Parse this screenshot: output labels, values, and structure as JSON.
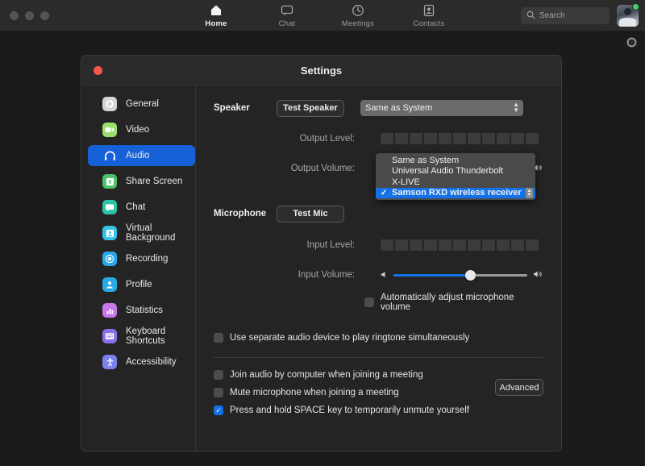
{
  "topbar": {
    "nav": [
      {
        "label": "Home",
        "icon": "home-icon",
        "active": true
      },
      {
        "label": "Chat",
        "icon": "chat-bubble-icon",
        "active": false
      },
      {
        "label": "Meetings",
        "icon": "clock-icon",
        "active": false
      },
      {
        "label": "Contacts",
        "icon": "contact-card-icon",
        "active": false
      }
    ],
    "search": {
      "placeholder": "Search",
      "icon": "search-icon"
    },
    "avatar": {
      "name": "user-avatar",
      "status": "available"
    },
    "gear": "gear-icon"
  },
  "settings": {
    "title": "Settings",
    "close_label": "close",
    "sidebar": [
      {
        "label": "General",
        "icon": "gear-icon",
        "color": "#d4d4d4",
        "active": false
      },
      {
        "label": "Video",
        "icon": "video-camera-icon",
        "color": "#9ade6f",
        "active": false
      },
      {
        "label": "Audio",
        "icon": "headphones-icon",
        "color": "#1661d8",
        "active": true
      },
      {
        "label": "Share Screen",
        "icon": "share-screen-icon",
        "color": "#4cc36a",
        "active": false
      },
      {
        "label": "Chat",
        "icon": "chat-bubble-icon",
        "color": "#2ec4a6",
        "active": false
      },
      {
        "label": "Virtual Background",
        "icon": "person-frame-icon",
        "color": "#36c3e8",
        "active": false
      },
      {
        "label": "Recording",
        "icon": "record-dot-icon",
        "color": "#2aa9e8",
        "active": false
      },
      {
        "label": "Profile",
        "icon": "person-icon",
        "color": "#29a9e6",
        "active": false
      },
      {
        "label": "Statistics",
        "icon": "bar-chart-icon",
        "color": "#c877e8",
        "active": false
      },
      {
        "label": "Keyboard Shortcuts",
        "icon": "keyboard-icon",
        "color": "#8a6fe8",
        "active": false
      },
      {
        "label": "Accessibility",
        "icon": "accessibility-icon",
        "color": "#7b82ea",
        "active": false
      }
    ],
    "speaker": {
      "section_label": "Speaker",
      "test_button": "Test Speaker",
      "selected_device": "Same as System",
      "output_level_label": "Output Level:",
      "output_level_segments": 11,
      "output_level_value": 0,
      "output_volume_label": "Output Volume:",
      "output_volume_percent": 10,
      "low_icon": "speaker-low-icon",
      "high_icon": "speaker-high-icon"
    },
    "microphone": {
      "section_label": "Microphone",
      "test_button": "Test Mic",
      "input_level_label": "Input Level:",
      "input_level_segments": 11,
      "input_level_value": 0,
      "input_volume_label": "Input Volume:",
      "input_volume_percent": 57,
      "low_icon": "mic-low-icon",
      "high_icon": "mic-high-icon",
      "auto_adjust": {
        "label": "Automatically adjust microphone volume",
        "checked": false
      }
    },
    "dropdown": {
      "open": true,
      "options": [
        {
          "label": "Same as System",
          "selected": false
        },
        {
          "label": "Universal Audio Thunderbolt",
          "selected": false
        },
        {
          "label": "X-LIVE",
          "selected": false
        },
        {
          "label": "Samson RXD wireless receiver",
          "selected": true
        }
      ],
      "check_glyph": "✓"
    },
    "options": [
      {
        "label": "Use separate audio device to play ringtone simultaneously",
        "checked": false
      },
      {
        "label": "Join audio by computer when joining a meeting",
        "checked": false
      },
      {
        "label": "Mute microphone when joining a meeting",
        "checked": false
      },
      {
        "label": "Press and hold SPACE key to temporarily unmute yourself",
        "checked": true
      }
    ],
    "advanced_button": "Advanced"
  },
  "colors": {
    "accent": "#1472e6",
    "sidebar_active": "#1661d8",
    "close_red": "#f3584f",
    "status_green": "#3ed463"
  }
}
